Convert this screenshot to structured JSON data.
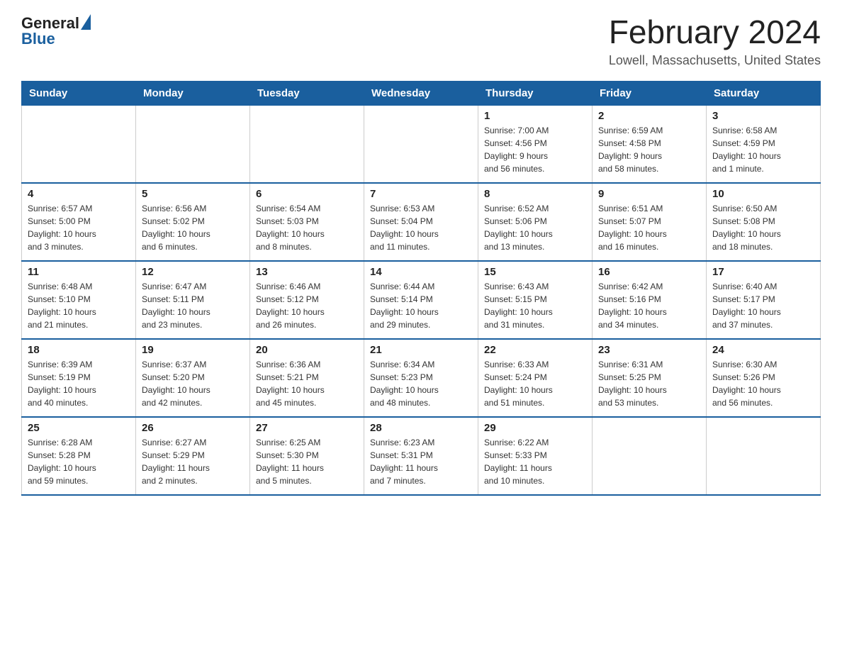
{
  "header": {
    "logo_general": "General",
    "logo_blue": "Blue",
    "month_title": "February 2024",
    "location": "Lowell, Massachusetts, United States"
  },
  "days_of_week": [
    "Sunday",
    "Monday",
    "Tuesday",
    "Wednesday",
    "Thursday",
    "Friday",
    "Saturday"
  ],
  "weeks": [
    [
      {
        "day": "",
        "info": ""
      },
      {
        "day": "",
        "info": ""
      },
      {
        "day": "",
        "info": ""
      },
      {
        "day": "",
        "info": ""
      },
      {
        "day": "1",
        "info": "Sunrise: 7:00 AM\nSunset: 4:56 PM\nDaylight: 9 hours\nand 56 minutes."
      },
      {
        "day": "2",
        "info": "Sunrise: 6:59 AM\nSunset: 4:58 PM\nDaylight: 9 hours\nand 58 minutes."
      },
      {
        "day": "3",
        "info": "Sunrise: 6:58 AM\nSunset: 4:59 PM\nDaylight: 10 hours\nand 1 minute."
      }
    ],
    [
      {
        "day": "4",
        "info": "Sunrise: 6:57 AM\nSunset: 5:00 PM\nDaylight: 10 hours\nand 3 minutes."
      },
      {
        "day": "5",
        "info": "Sunrise: 6:56 AM\nSunset: 5:02 PM\nDaylight: 10 hours\nand 6 minutes."
      },
      {
        "day": "6",
        "info": "Sunrise: 6:54 AM\nSunset: 5:03 PM\nDaylight: 10 hours\nand 8 minutes."
      },
      {
        "day": "7",
        "info": "Sunrise: 6:53 AM\nSunset: 5:04 PM\nDaylight: 10 hours\nand 11 minutes."
      },
      {
        "day": "8",
        "info": "Sunrise: 6:52 AM\nSunset: 5:06 PM\nDaylight: 10 hours\nand 13 minutes."
      },
      {
        "day": "9",
        "info": "Sunrise: 6:51 AM\nSunset: 5:07 PM\nDaylight: 10 hours\nand 16 minutes."
      },
      {
        "day": "10",
        "info": "Sunrise: 6:50 AM\nSunset: 5:08 PM\nDaylight: 10 hours\nand 18 minutes."
      }
    ],
    [
      {
        "day": "11",
        "info": "Sunrise: 6:48 AM\nSunset: 5:10 PM\nDaylight: 10 hours\nand 21 minutes."
      },
      {
        "day": "12",
        "info": "Sunrise: 6:47 AM\nSunset: 5:11 PM\nDaylight: 10 hours\nand 23 minutes."
      },
      {
        "day": "13",
        "info": "Sunrise: 6:46 AM\nSunset: 5:12 PM\nDaylight: 10 hours\nand 26 minutes."
      },
      {
        "day": "14",
        "info": "Sunrise: 6:44 AM\nSunset: 5:14 PM\nDaylight: 10 hours\nand 29 minutes."
      },
      {
        "day": "15",
        "info": "Sunrise: 6:43 AM\nSunset: 5:15 PM\nDaylight: 10 hours\nand 31 minutes."
      },
      {
        "day": "16",
        "info": "Sunrise: 6:42 AM\nSunset: 5:16 PM\nDaylight: 10 hours\nand 34 minutes."
      },
      {
        "day": "17",
        "info": "Sunrise: 6:40 AM\nSunset: 5:17 PM\nDaylight: 10 hours\nand 37 minutes."
      }
    ],
    [
      {
        "day": "18",
        "info": "Sunrise: 6:39 AM\nSunset: 5:19 PM\nDaylight: 10 hours\nand 40 minutes."
      },
      {
        "day": "19",
        "info": "Sunrise: 6:37 AM\nSunset: 5:20 PM\nDaylight: 10 hours\nand 42 minutes."
      },
      {
        "day": "20",
        "info": "Sunrise: 6:36 AM\nSunset: 5:21 PM\nDaylight: 10 hours\nand 45 minutes."
      },
      {
        "day": "21",
        "info": "Sunrise: 6:34 AM\nSunset: 5:23 PM\nDaylight: 10 hours\nand 48 minutes."
      },
      {
        "day": "22",
        "info": "Sunrise: 6:33 AM\nSunset: 5:24 PM\nDaylight: 10 hours\nand 51 minutes."
      },
      {
        "day": "23",
        "info": "Sunrise: 6:31 AM\nSunset: 5:25 PM\nDaylight: 10 hours\nand 53 minutes."
      },
      {
        "day": "24",
        "info": "Sunrise: 6:30 AM\nSunset: 5:26 PM\nDaylight: 10 hours\nand 56 minutes."
      }
    ],
    [
      {
        "day": "25",
        "info": "Sunrise: 6:28 AM\nSunset: 5:28 PM\nDaylight: 10 hours\nand 59 minutes."
      },
      {
        "day": "26",
        "info": "Sunrise: 6:27 AM\nSunset: 5:29 PM\nDaylight: 11 hours\nand 2 minutes."
      },
      {
        "day": "27",
        "info": "Sunrise: 6:25 AM\nSunset: 5:30 PM\nDaylight: 11 hours\nand 5 minutes."
      },
      {
        "day": "28",
        "info": "Sunrise: 6:23 AM\nSunset: 5:31 PM\nDaylight: 11 hours\nand 7 minutes."
      },
      {
        "day": "29",
        "info": "Sunrise: 6:22 AM\nSunset: 5:33 PM\nDaylight: 11 hours\nand 10 minutes."
      },
      {
        "day": "",
        "info": ""
      },
      {
        "day": "",
        "info": ""
      }
    ]
  ]
}
